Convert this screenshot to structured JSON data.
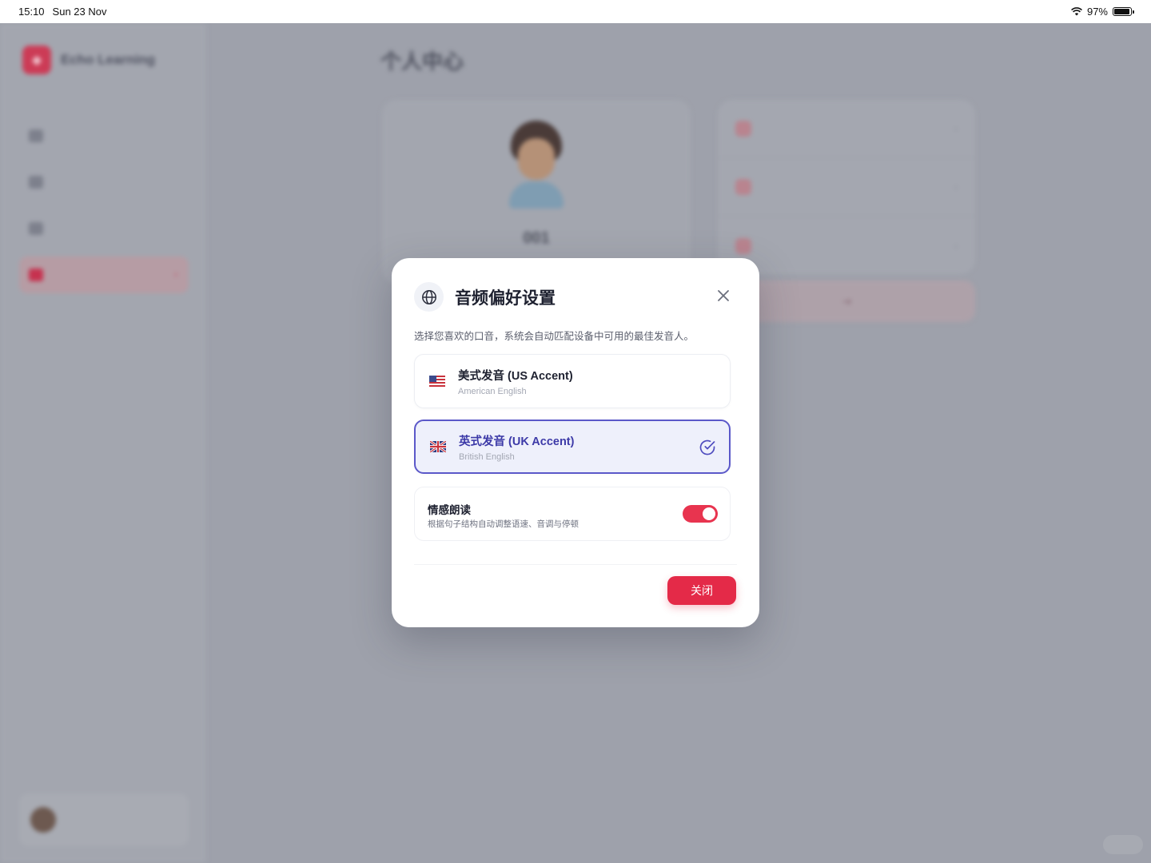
{
  "status_bar": {
    "time": "15:10",
    "date": "Sun 23 Nov",
    "battery": "97%",
    "battery_level": 0.97
  },
  "background_app": {
    "brand": "Echo Learning",
    "page_title": "个人中心",
    "profile_name": "001"
  },
  "modal": {
    "title": "音频偏好设置",
    "description": "选择您喜欢的口音，系统会自动匹配设备中可用的最佳发音人。",
    "options": [
      {
        "flag": "us-flag-icon",
        "label": "美式发音 (US Accent)",
        "sub": "American English",
        "selected": false
      },
      {
        "flag": "uk-flag-icon",
        "label": "英式发音 (UK Accent)",
        "sub": "British English",
        "selected": true
      }
    ],
    "emotion": {
      "title": "情感朗读",
      "subtitle": "根据句子结构自动调整语速、音调与停顿",
      "enabled": true
    },
    "close_button": "关闭"
  },
  "colors": {
    "accent_red": "#e42a48",
    "selected_purple": "#5b58c9",
    "toggle_on": "#e8344f"
  }
}
